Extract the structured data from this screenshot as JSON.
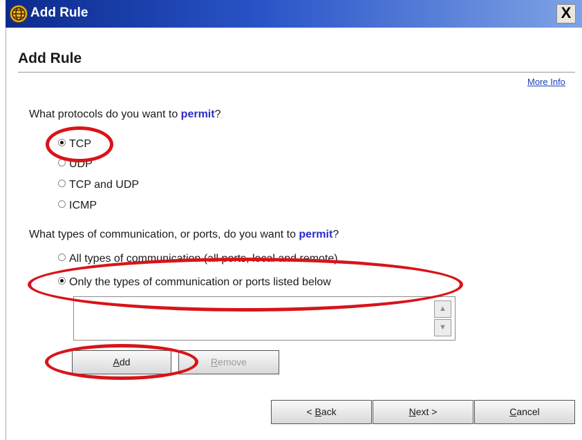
{
  "window": {
    "title": "Add Rule",
    "close_label": "X"
  },
  "page": {
    "heading": "Add Rule",
    "more_info": "More Info"
  },
  "protocols": {
    "question_prefix": "What protocols do you want to ",
    "question_keyword": "permit",
    "question_suffix": "?",
    "options": [
      {
        "label": "TCP",
        "selected": true
      },
      {
        "label": "UDP",
        "selected": false
      },
      {
        "label": "TCP and UDP",
        "selected": false
      },
      {
        "label": "ICMP",
        "selected": false
      }
    ]
  },
  "ports": {
    "question_prefix": "What types of communication, or ports, do you want to ",
    "question_keyword": "permit",
    "question_suffix": "?",
    "options": [
      {
        "label": "All types of communication (all ports, local and remote)",
        "selected": false
      },
      {
        "label": "Only the types of communication or ports listed below",
        "selected": true
      }
    ],
    "list_items": []
  },
  "list_actions": {
    "add_label": "Add",
    "add_mnemonic": "A",
    "add_rest": "dd",
    "remove_label": "Remove",
    "remove_mnemonic": "R",
    "remove_rest": "emove"
  },
  "footer": {
    "back_prefix": "< ",
    "back_mnemonic": "B",
    "back_rest": "ack",
    "next_mnemonic": "N",
    "next_rest": "ext >",
    "cancel_mnemonic": "C",
    "cancel_rest": "ancel"
  },
  "colors": {
    "title_bar": "#0b2a8c",
    "keyword": "#2d2bc9",
    "link": "#1a3fb6",
    "annotation": "#d8141a"
  }
}
